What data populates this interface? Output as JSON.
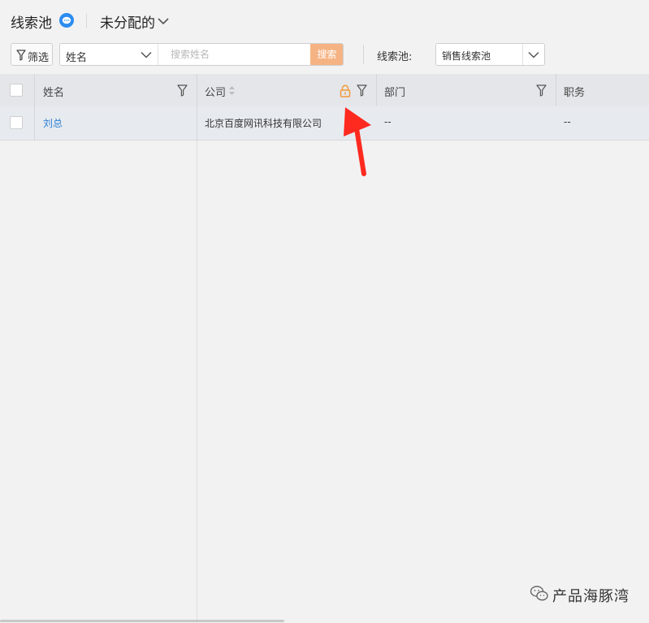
{
  "header": {
    "title": "线索池",
    "view_label": "未分配的"
  },
  "toolbar": {
    "filter_label": "筛选",
    "search_field": "姓名",
    "search_placeholder": "搜索姓名",
    "search_button": "搜索",
    "pool_label": "线索池:",
    "pool_value": "销售线索池"
  },
  "table": {
    "columns": [
      "姓名",
      "公司",
      "部门",
      "职务"
    ],
    "rows": [
      {
        "name": "刘总",
        "company": "北京百度网讯科技有限公司",
        "department": "--",
        "position": "--"
      }
    ]
  },
  "colors": {
    "link": "#2d7fd3",
    "accent_orange": "#f39a3c",
    "search_button": "#f5b383",
    "arrow": "#ff2a1f"
  },
  "watermark": {
    "text": "产品海豚湾"
  }
}
